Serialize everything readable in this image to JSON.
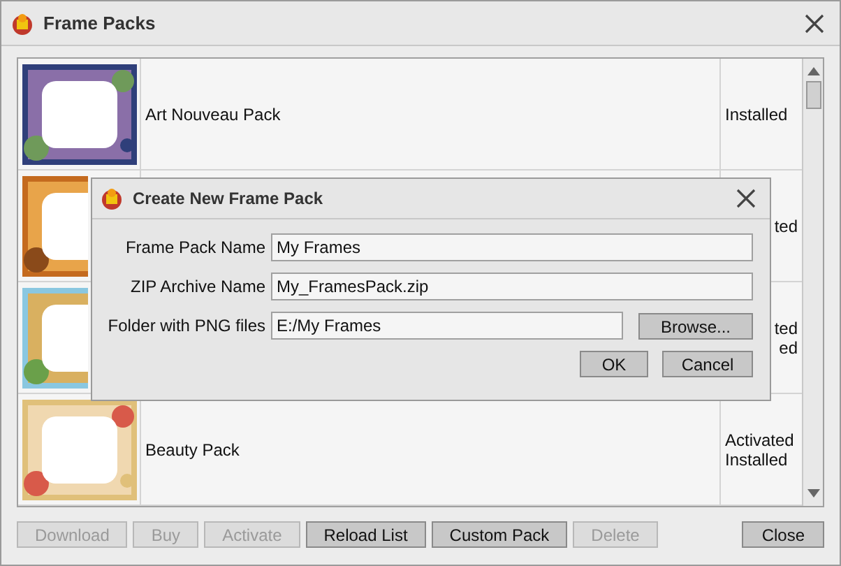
{
  "window": {
    "title": "Frame Packs"
  },
  "packs": [
    {
      "name": "Art Nouveau Pack",
      "status": [
        "Installed"
      ],
      "cut_off": false
    },
    {
      "status": [
        "ted"
      ],
      "cut_off": true
    },
    {
      "status": [
        "ted",
        "ed"
      ],
      "cut_off": true
    },
    {
      "name": "Beauty Pack",
      "status": [
        "Activated",
        "Installed"
      ],
      "cut_off": false
    }
  ],
  "buttons": [
    {
      "label": "Download",
      "disabled": true
    },
    {
      "label": "Buy",
      "disabled": true
    },
    {
      "label": "Activate",
      "disabled": true
    },
    {
      "label": "Reload List",
      "disabled": false
    },
    {
      "label": "Custom Pack",
      "disabled": false
    },
    {
      "label": "Delete",
      "disabled": true
    }
  ],
  "close_button": "Close",
  "dialog": {
    "title": "Create New Frame Pack",
    "fields": [
      {
        "label": "Frame Pack Name",
        "value": "My Frames"
      },
      {
        "label": "ZIP Archive Name",
        "value": "My_FramesPack.zip"
      },
      {
        "label": "Folder with PNG files",
        "value": "E:/My Frames",
        "browse": "Browse..."
      }
    ],
    "buttons": [
      "OK",
      "Cancel"
    ]
  }
}
